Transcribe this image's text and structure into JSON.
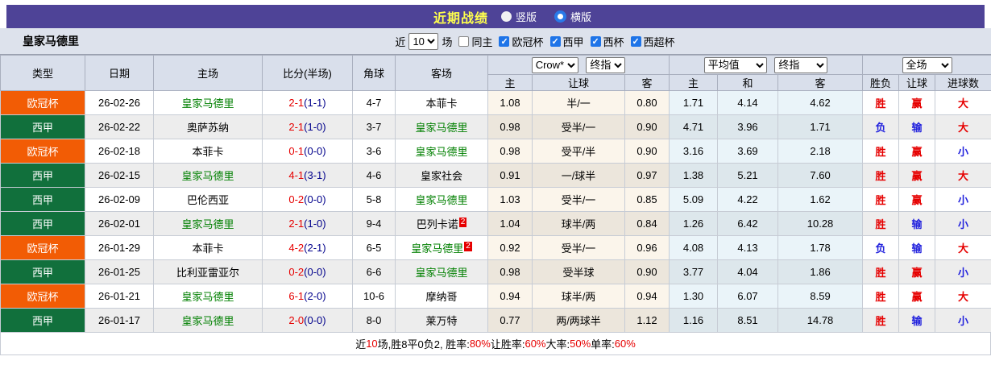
{
  "colors": {
    "purple": "#4e4397",
    "title_yellow": "#ffff4d",
    "ucl": "#f25c05",
    "liga": "#11703c",
    "team_green": "#008000",
    "red": "#e60000",
    "blue": "#2222dd",
    "navy": "#00008b",
    "check_blue": "#1e74e8"
  },
  "topbar": {
    "title": "近期战绩",
    "view_modes": [
      {
        "label": "竖版",
        "selected": false
      },
      {
        "label": "横版",
        "selected": true
      }
    ]
  },
  "toolbar": {
    "team": "皇家马德里",
    "near_label": "近",
    "matches_value": "10",
    "matches_suffix": "场",
    "same_home": {
      "label": "同主",
      "checked": false
    },
    "filters": [
      {
        "label": "欧冠杯",
        "checked": true
      },
      {
        "label": "西甲",
        "checked": true
      },
      {
        "label": "西杯",
        "checked": true
      },
      {
        "label": "西超杯",
        "checked": true
      }
    ]
  },
  "table": {
    "main_headers": [
      "类型",
      "日期",
      "主场",
      "比分(半场)",
      "角球",
      "客场"
    ],
    "selects": [
      "Crow*",
      "终指",
      "平均值",
      "终指",
      "全场"
    ],
    "sub_headers": [
      "主",
      "让球",
      "客",
      "主",
      "和",
      "客",
      "胜负",
      "让球",
      "进球数"
    ],
    "rows": [
      {
        "league": {
          "label": "欧冠杯",
          "key": "ucl"
        },
        "date": "26-02-26",
        "home": {
          "name": "皇家马德里",
          "rm": true,
          "red_card": ""
        },
        "score": {
          "full": "2-1",
          "half": "(1-1)"
        },
        "corner": "4-7",
        "away": {
          "name": "本菲卡",
          "rm": false,
          "red_card": ""
        },
        "crow": {
          "home": "1.08",
          "handicap": "半/一",
          "away": "0.80"
        },
        "avg": {
          "home": "1.71",
          "draw": "4.14",
          "away": "4.62"
        },
        "results": [
          {
            "text": "胜",
            "win": true
          },
          {
            "text": "赢",
            "win": true
          },
          {
            "text": "大",
            "win": true
          }
        ]
      },
      {
        "league": {
          "label": "西甲",
          "key": "liga"
        },
        "date": "26-02-22",
        "home": {
          "name": "奥萨苏纳",
          "rm": false,
          "red_card": ""
        },
        "score": {
          "full": "2-1",
          "half": "(1-0)"
        },
        "corner": "3-7",
        "away": {
          "name": "皇家马德里",
          "rm": true,
          "red_card": ""
        },
        "crow": {
          "home": "0.98",
          "handicap": "受半/一",
          "away": "0.90"
        },
        "avg": {
          "home": "4.71",
          "draw": "3.96",
          "away": "1.71"
        },
        "results": [
          {
            "text": "负",
            "win": false
          },
          {
            "text": "输",
            "win": false
          },
          {
            "text": "大",
            "win": true
          }
        ]
      },
      {
        "league": {
          "label": "欧冠杯",
          "key": "ucl"
        },
        "date": "26-02-18",
        "home": {
          "name": "本菲卡",
          "rm": false,
          "red_card": ""
        },
        "score": {
          "full": "0-1",
          "half": "(0-0)"
        },
        "corner": "3-6",
        "away": {
          "name": "皇家马德里",
          "rm": true,
          "red_card": ""
        },
        "crow": {
          "home": "0.98",
          "handicap": "受平/半",
          "away": "0.90"
        },
        "avg": {
          "home": "3.16",
          "draw": "3.69",
          "away": "2.18"
        },
        "results": [
          {
            "text": "胜",
            "win": true
          },
          {
            "text": "赢",
            "win": true
          },
          {
            "text": "小",
            "win": false
          }
        ]
      },
      {
        "league": {
          "label": "西甲",
          "key": "liga"
        },
        "date": "26-02-15",
        "home": {
          "name": "皇家马德里",
          "rm": true,
          "red_card": ""
        },
        "score": {
          "full": "4-1",
          "half": "(3-1)"
        },
        "corner": "4-6",
        "away": {
          "name": "皇家社会",
          "rm": false,
          "red_card": ""
        },
        "crow": {
          "home": "0.91",
          "handicap": "一/球半",
          "away": "0.97"
        },
        "avg": {
          "home": "1.38",
          "draw": "5.21",
          "away": "7.60"
        },
        "results": [
          {
            "text": "胜",
            "win": true
          },
          {
            "text": "赢",
            "win": true
          },
          {
            "text": "大",
            "win": true
          }
        ]
      },
      {
        "league": {
          "label": "西甲",
          "key": "liga"
        },
        "date": "26-02-09",
        "home": {
          "name": "巴伦西亚",
          "rm": false,
          "red_card": ""
        },
        "score": {
          "full": "0-2",
          "half": "(0-0)"
        },
        "corner": "5-8",
        "away": {
          "name": "皇家马德里",
          "rm": true,
          "red_card": ""
        },
        "crow": {
          "home": "1.03",
          "handicap": "受半/一",
          "away": "0.85"
        },
        "avg": {
          "home": "5.09",
          "draw": "4.22",
          "away": "1.62"
        },
        "results": [
          {
            "text": "胜",
            "win": true
          },
          {
            "text": "赢",
            "win": true
          },
          {
            "text": "小",
            "win": false
          }
        ]
      },
      {
        "league": {
          "label": "西甲",
          "key": "liga"
        },
        "date": "26-02-01",
        "home": {
          "name": "皇家马德里",
          "rm": true,
          "red_card": ""
        },
        "score": {
          "full": "2-1",
          "half": "(1-0)"
        },
        "corner": "9-4",
        "away": {
          "name": "巴列卡诺",
          "rm": false,
          "red_card": "2"
        },
        "crow": {
          "home": "1.04",
          "handicap": "球半/两",
          "away": "0.84"
        },
        "avg": {
          "home": "1.26",
          "draw": "6.42",
          "away": "10.28"
        },
        "results": [
          {
            "text": "胜",
            "win": true
          },
          {
            "text": "输",
            "win": false
          },
          {
            "text": "小",
            "win": false
          }
        ]
      },
      {
        "league": {
          "label": "欧冠杯",
          "key": "ucl"
        },
        "date": "26-01-29",
        "home": {
          "name": "本菲卡",
          "rm": false,
          "red_card": ""
        },
        "score": {
          "full": "4-2",
          "half": "(2-1)"
        },
        "corner": "6-5",
        "away": {
          "name": "皇家马德里",
          "rm": true,
          "red_card": "2"
        },
        "crow": {
          "home": "0.92",
          "handicap": "受半/一",
          "away": "0.96"
        },
        "avg": {
          "home": "4.08",
          "draw": "4.13",
          "away": "1.78"
        },
        "results": [
          {
            "text": "负",
            "win": false
          },
          {
            "text": "输",
            "win": false
          },
          {
            "text": "大",
            "win": true
          }
        ]
      },
      {
        "league": {
          "label": "西甲",
          "key": "liga"
        },
        "date": "26-01-25",
        "home": {
          "name": "比利亚雷亚尔",
          "rm": false,
          "red_card": ""
        },
        "score": {
          "full": "0-2",
          "half": "(0-0)"
        },
        "corner": "6-6",
        "away": {
          "name": "皇家马德里",
          "rm": true,
          "red_card": ""
        },
        "crow": {
          "home": "0.98",
          "handicap": "受半球",
          "away": "0.90"
        },
        "avg": {
          "home": "3.77",
          "draw": "4.04",
          "away": "1.86"
        },
        "results": [
          {
            "text": "胜",
            "win": true
          },
          {
            "text": "赢",
            "win": true
          },
          {
            "text": "小",
            "win": false
          }
        ]
      },
      {
        "league": {
          "label": "欧冠杯",
          "key": "ucl"
        },
        "date": "26-01-21",
        "home": {
          "name": "皇家马德里",
          "rm": true,
          "red_card": ""
        },
        "score": {
          "full": "6-1",
          "half": "(2-0)"
        },
        "corner": "10-6",
        "away": {
          "name": "摩纳哥",
          "rm": false,
          "red_card": ""
        },
        "crow": {
          "home": "0.94",
          "handicap": "球半/两",
          "away": "0.94"
        },
        "avg": {
          "home": "1.30",
          "draw": "6.07",
          "away": "8.59"
        },
        "results": [
          {
            "text": "胜",
            "win": true
          },
          {
            "text": "赢",
            "win": true
          },
          {
            "text": "大",
            "win": true
          }
        ]
      },
      {
        "league": {
          "label": "西甲",
          "key": "liga"
        },
        "date": "26-01-17",
        "home": {
          "name": "皇家马德里",
          "rm": true,
          "red_card": ""
        },
        "score": {
          "full": "2-0",
          "half": "(0-0)"
        },
        "corner": "8-0",
        "away": {
          "name": "莱万特",
          "rm": false,
          "red_card": ""
        },
        "crow": {
          "home": "0.77",
          "handicap": "两/两球半",
          "away": "1.12"
        },
        "avg": {
          "home": "1.16",
          "draw": "8.51",
          "away": "14.78"
        },
        "results": [
          {
            "text": "胜",
            "win": true
          },
          {
            "text": "输",
            "win": false
          },
          {
            "text": "小",
            "win": false
          }
        ]
      }
    ]
  },
  "footer": {
    "segments": [
      {
        "text": "近",
        "red": false
      },
      {
        "text": "10",
        "red": true
      },
      {
        "text": "场,胜8平0负2, 胜率:",
        "red": false
      },
      {
        "text": "80%",
        "red": true
      },
      {
        "text": " 让胜率:",
        "red": false
      },
      {
        "text": "60%",
        "red": true
      },
      {
        "text": " 大率:",
        "red": false
      },
      {
        "text": "50%",
        "red": true
      },
      {
        "text": " 单率:",
        "red": false
      },
      {
        "text": "60%",
        "red": true
      }
    ]
  }
}
